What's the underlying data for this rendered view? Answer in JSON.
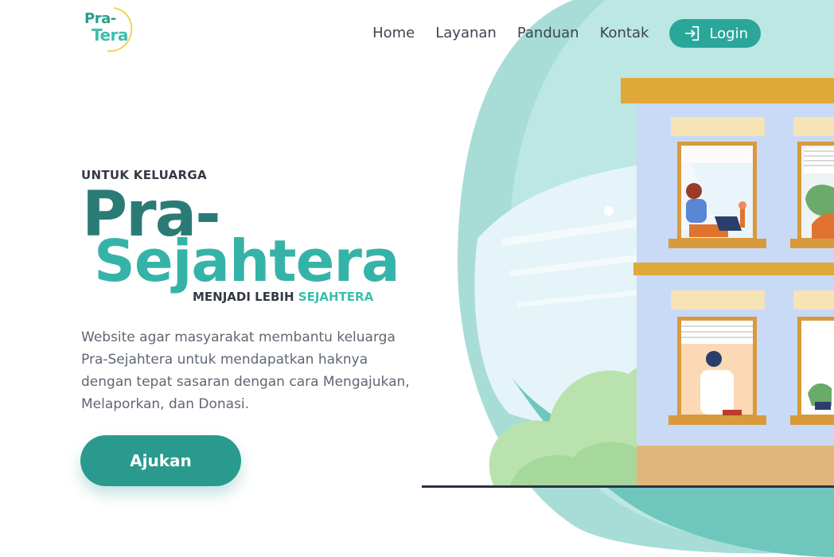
{
  "brand": {
    "logo_line1": "Pra-",
    "logo_line2": "Tera"
  },
  "nav": {
    "items": [
      {
        "label": "Home"
      },
      {
        "label": "Layanan"
      },
      {
        "label": "Panduan"
      },
      {
        "label": "Kontak"
      }
    ],
    "login_label": "Login",
    "login_icon": "login-icon"
  },
  "hero": {
    "eyebrow": "UNTUK KELUARGA",
    "title_line1": "Pra-",
    "title_line2": "Sejahtera",
    "subline_prefix": "MENJADI LEBIH",
    "subline_accent": "SEJAHTERA",
    "description": "Website agar masyarakat membantu keluarga Pra-Sejahtera untuk mendapatkan haknya dengan tepat sasaran dengan cara Mengajukan, Melaporkan, dan Donasi.",
    "cta_label": "Ajukan"
  },
  "colors": {
    "primary": "#2a9a8f",
    "accent": "#3bbfad",
    "title_dark": "#2a7b76",
    "text": "#5f6773"
  }
}
